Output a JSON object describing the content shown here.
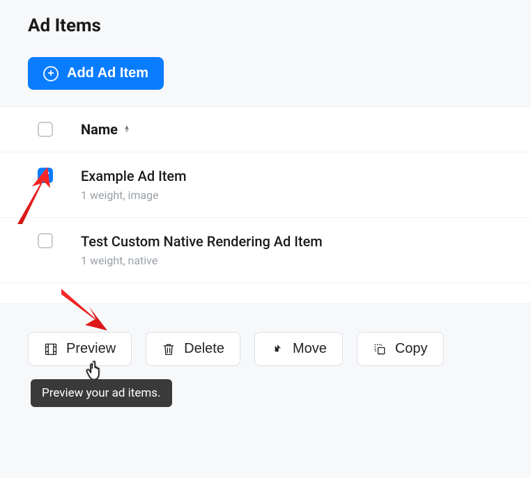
{
  "header": {
    "title": "Ad Items",
    "add_button_label": "Add Ad Item"
  },
  "table": {
    "name_header": "Name",
    "rows": [
      {
        "checked": true,
        "name": "Example Ad Item",
        "meta": "1 weight,  image"
      },
      {
        "checked": false,
        "name": "Test Custom Native Rendering Ad Item",
        "meta": "1 weight,  native"
      }
    ]
  },
  "actions": {
    "preview": "Preview",
    "delete": "Delete",
    "move": "Move",
    "copy": "Copy"
  },
  "tooltip": {
    "preview": "Preview your ad items."
  }
}
